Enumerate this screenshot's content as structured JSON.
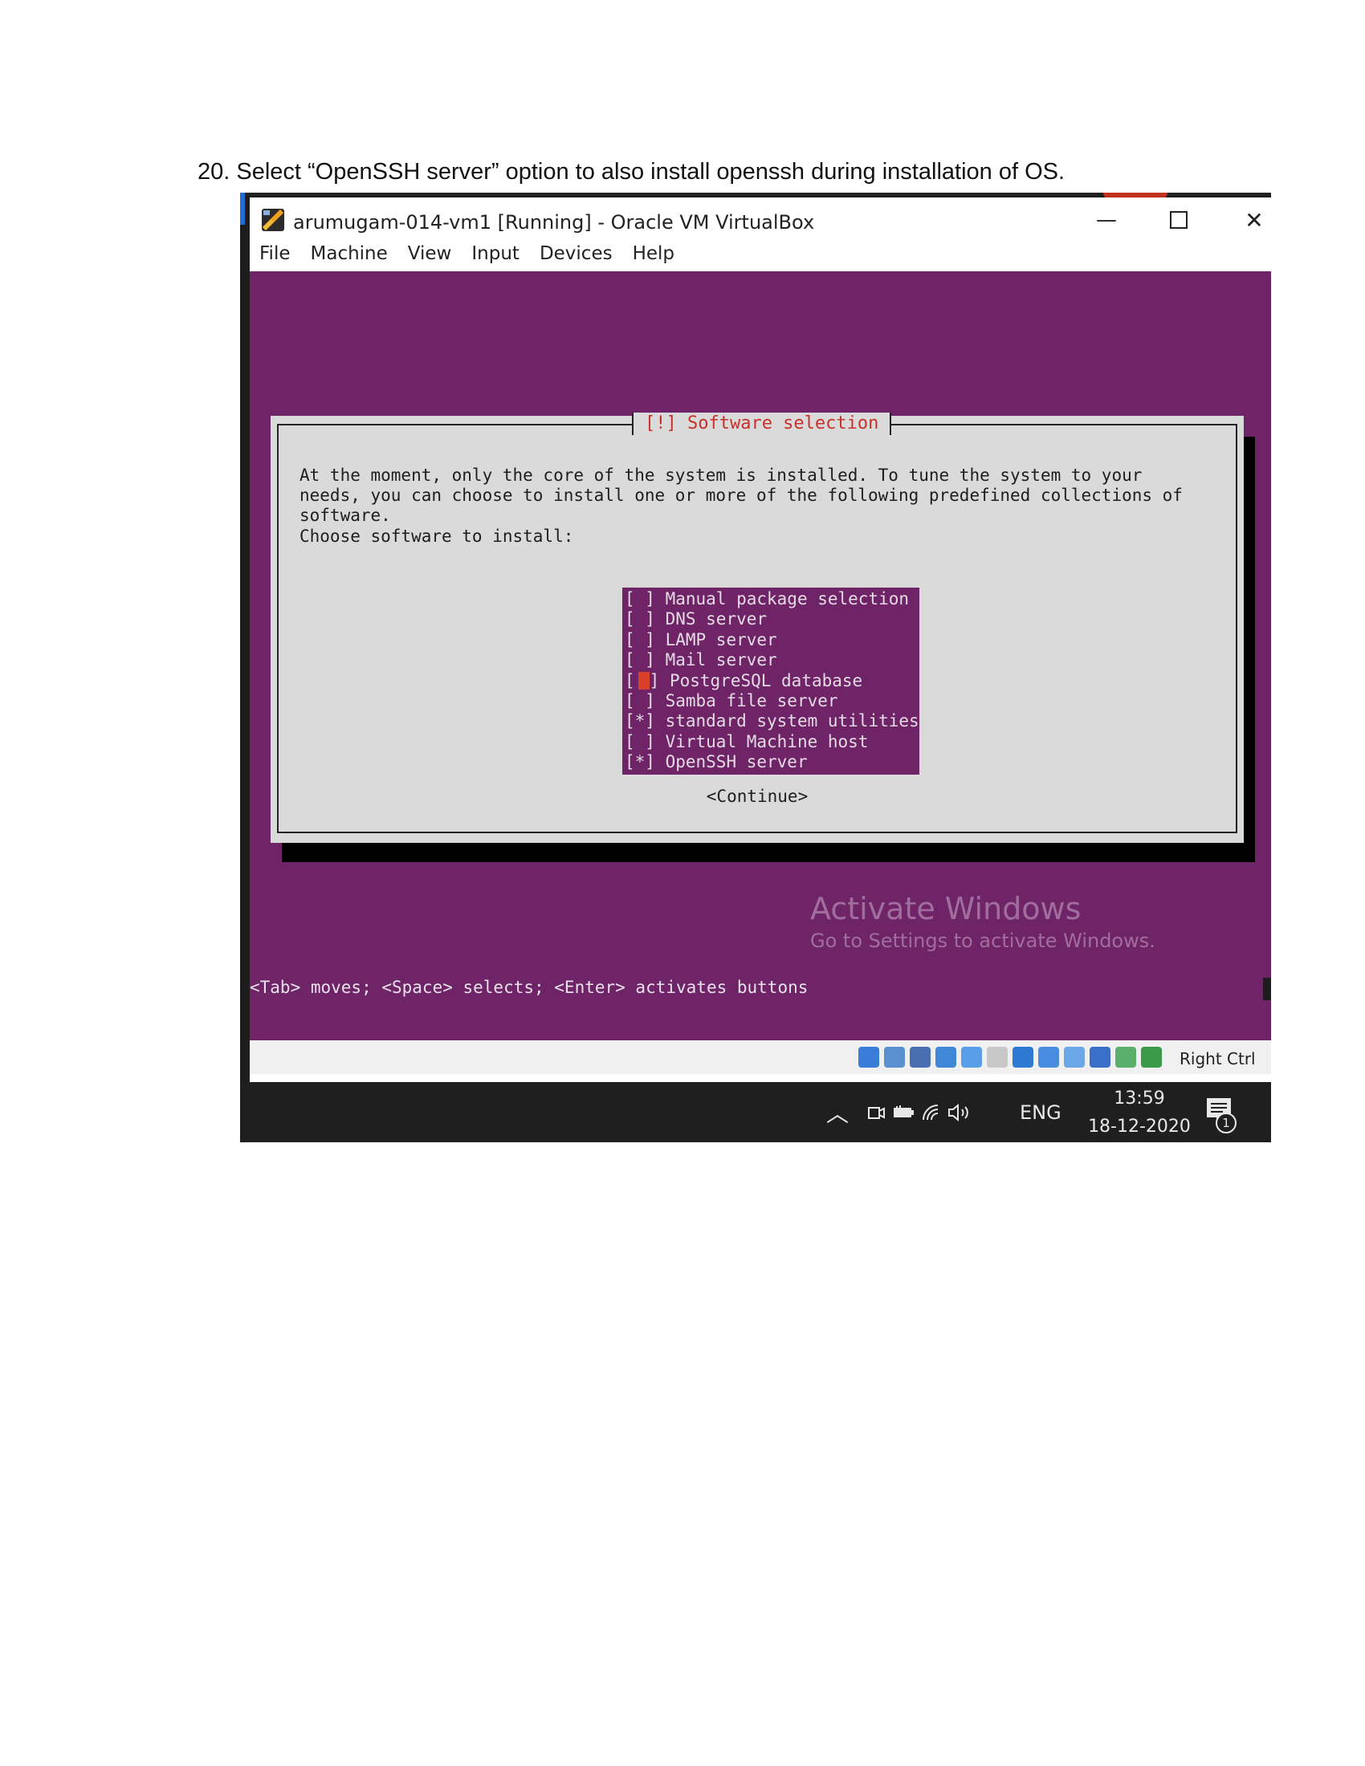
{
  "instruction": "20. Select “OpenSSH server” option to also install openssh during installation of OS.",
  "window": {
    "title": "arumugam-014-vm1 [Running] - Oracle VM VirtualBox",
    "minimize": "—",
    "close": "✕"
  },
  "menu": [
    "File",
    "Machine",
    "View",
    "Input",
    "Devices",
    "Help"
  ],
  "dialog": {
    "title": "[!] Software selection",
    "description": "At the moment, only the core of the system is installed. To tune the system to your\nneeds, you can choose to install one or more of the following predefined collections of\nsoftware.",
    "prompt": "Choose software to install:",
    "options": [
      {
        "mark": "[ ]",
        "label": "Manual package selection",
        "checked": false
      },
      {
        "mark": "[ ]",
        "label": "DNS server",
        "checked": false
      },
      {
        "mark": "[ ]",
        "label": "LAMP server",
        "checked": false
      },
      {
        "mark": "[ ]",
        "label": "Mail server",
        "checked": false
      },
      {
        "mark": "[ ]",
        "label": "PostgreSQL database",
        "checked": false,
        "cursor": true
      },
      {
        "mark": "[ ]",
        "label": "Samba file server",
        "checked": false
      },
      {
        "mark": "[*]",
        "label": "standard system utilities",
        "checked": true
      },
      {
        "mark": "[ ]",
        "label": "Virtual Machine host",
        "checked": false
      },
      {
        "mark": "[*]",
        "label": "OpenSSH server",
        "checked": true
      }
    ],
    "continue": "<Continue>"
  },
  "activation": {
    "title": "Activate Windows",
    "subtitle": "Go to Settings to activate Windows."
  },
  "hint": "<Tab> moves; <Space> selects; <Enter> activates buttons",
  "statusbar": {
    "host_key": "Right Ctrl",
    "icons": [
      "hard-disk-icon",
      "optical-drive-icon",
      "audio-icon",
      "network-icon",
      "usb-icon",
      "shared-folders-icon",
      "display-icon",
      "video-capture-icon",
      "guest-additions-icon",
      "cpu-icon",
      "mouse-integration-icon",
      "keyboard-icon"
    ],
    "icon_colors": [
      "#3a7dd8",
      "#5a8fd0",
      "#4a6fb0",
      "#3f88d8",
      "#5a9ee8",
      "#c8c8c8",
      "#2e7ad2",
      "#4a8de0",
      "#6aa6e8",
      "#3a6fc8",
      "#5ab06a",
      "#3a9a4a"
    ]
  },
  "taskbar": {
    "language": "ENG",
    "time": "13:59",
    "date": "18-12-2020",
    "notifications": "1"
  },
  "colors": {
    "vm_background": "#6f2468",
    "dialog_background": "#dadada",
    "dialog_title": "#c8302a",
    "cursor": "#d8402a"
  }
}
